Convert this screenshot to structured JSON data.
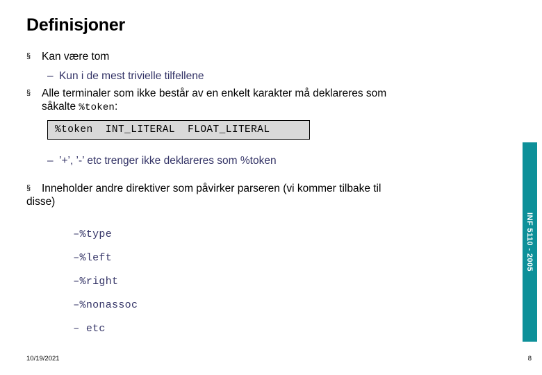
{
  "slide": {
    "title": "Definisjoner",
    "colors": {
      "accent_teal": "#0d9099",
      "sub_bullet_navy": "#333366",
      "code_box_bg": "#d9d9d9",
      "text_black": "#000000"
    }
  },
  "content": {
    "bullet1": {
      "marker": "§",
      "text": "Kan være tom"
    },
    "sub_bullet1": {
      "dash": "–",
      "text": "Kun i de mest trivielle tilfellene"
    },
    "bullet2": {
      "marker": "§",
      "line1": "Alle terminaler som ikke består av en enkelt karakter må deklareres som",
      "line2_prefix": "såkalte ",
      "line2_code": "%token",
      "line2_suffix": ":"
    },
    "code_box": {
      "text": "%token  INT_LITERAL  FLOAT_LITERAL"
    },
    "sub_bullet2": {
      "dash": "–",
      "text": "’+’, ’-’ etc trenger ikke deklareres som %token"
    },
    "bullet3": {
      "marker": "§",
      "line1": "Inneholder andre direktiver som påvirker parseren (vi kommer tilbake til",
      "line2": "disse)"
    },
    "directives": [
      {
        "dash": "–",
        "text": "%type"
      },
      {
        "dash": "–",
        "text": "%left"
      },
      {
        "dash": "–",
        "text": "%right"
      },
      {
        "dash": "–",
        "text": "%nonassoc"
      },
      {
        "dash": "–",
        "text": " etc"
      }
    ]
  },
  "side_bar": {
    "label": "INF 5110 - 2005"
  },
  "footer": {
    "date": "10/19/2021",
    "page_number": "8"
  }
}
